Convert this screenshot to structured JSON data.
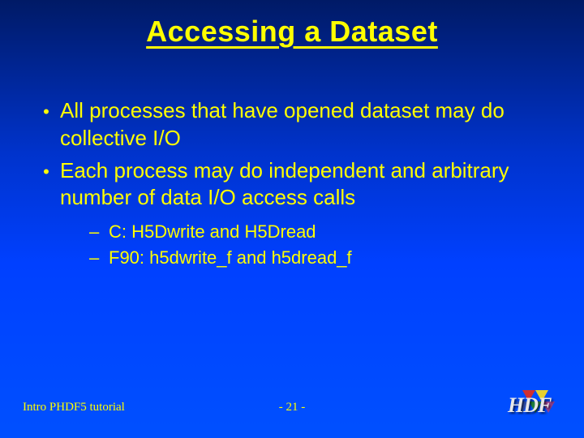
{
  "title": "Accessing a Dataset",
  "bullets": [
    {
      "text": "All processes that have opened dataset may do collective I/O"
    },
    {
      "text": "Each process may do independent and arbitrary number of data I/O access calls"
    }
  ],
  "subbullets": [
    {
      "text": "C:    H5Dwrite and H5Dread"
    },
    {
      "text": "F90: h5dwrite_f and h5dread_f"
    }
  ],
  "footer": {
    "left": "Intro PHDF5 tutorial",
    "center": "- 21 -",
    "logo_text": "HDF"
  }
}
